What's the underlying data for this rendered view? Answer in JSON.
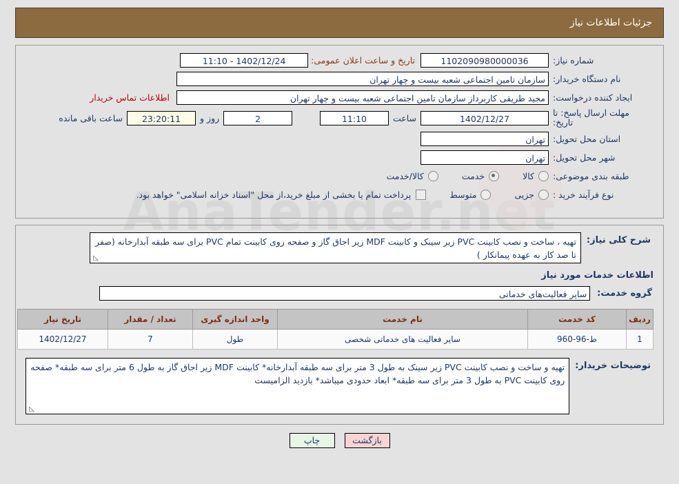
{
  "header": {
    "title": "جزئیات اطلاعات نیاز"
  },
  "colors": {
    "header_bar": "#8b6b3f",
    "page_background": "#e3e3e3",
    "label_text": "#1f3864",
    "link_red": "#c00000",
    "announce_label": "#8a3a10",
    "table_header_bg": "#c4c4c4",
    "table_header_text": "#7b2d13",
    "countdown_bg": "#fdfce4",
    "print_button_bg": "#e7f6e7",
    "back_button_bg": "#fbd3d3"
  },
  "watermark": {
    "text": "AnaTender.net"
  },
  "info": {
    "need_number_label": "شماره نیاز:",
    "need_number_value": "1102090980000036",
    "announce_label": "تاریخ و ساعت اعلان عمومی:",
    "announce_value": "1402/12/24 - 11:10",
    "buyer_org_label": "نام دستگاه خریدار:",
    "buyer_org_value": "سازمان تامین اجتماعی شعبه بیست و چهار تهران",
    "creator_label": "ایجاد کننده درخواست:",
    "creator_value": "مجید طریقی کاربرداز سازمان تامین اجتماعی شعبه بیست و چهار تهران",
    "contact_link": "اطلاعات تماس خریدار",
    "deadline_label_line1": "مهلت ارسال پاسخ: تا",
    "deadline_label_line2": "تاریخ:",
    "deadline_date": "1402/12/27",
    "hour_label": "ساعت",
    "deadline_time": "11:10",
    "days_value": "2",
    "days_label": "روز و",
    "countdown_value": "23:20:11",
    "remaining_label": "ساعت باقی مانده",
    "province_label": "استان محل تحویل:",
    "province_value": "تهران",
    "city_label": "شهر محل تحویل:",
    "city_value": "تهران",
    "category_label": "طبقه بندی موضوعی:",
    "category_options": [
      {
        "label": "کالا",
        "selected": false
      },
      {
        "label": "خدمت",
        "selected": true
      },
      {
        "label": "کالا/خدمت",
        "selected": false
      }
    ],
    "process_label": "نوع فرآیند خرید :",
    "process_options": [
      {
        "label": "جزیی",
        "selected": false
      },
      {
        "label": "متوسط",
        "selected": false
      }
    ],
    "treasury_checkbox_checked": false,
    "treasury_note": "پرداخت تمام یا بخشی از مبلغ خرید،از محل \"اسناد خزانه اسلامی\" خواهد بود."
  },
  "description": {
    "need_summary_label": "شرح کلی نیاز:",
    "need_summary_value": "تهیه ، ساخت و نصب کابینت PVC زیر سینک و کابینت MDF زیر اجاق گاز و صفحه روی کابینت تمام PVC  برای سه طبقه آبدارخانه (صفر تا صد کار به عهده پیمانکار )",
    "services_heading": "اطلاعات خدمات مورد نیاز",
    "service_group_label": "گروه خدمت:",
    "service_group_value": "سایر فعالیت‌های خدماتی",
    "buyer_notes_label": "توضیحات خریدار:",
    "buyer_notes_value": "تهیه و ساخت و نصب کابینت PVC زیر سینک به طول 3 متر برای سه طبقه آبدارخانه* کابینت MDF زیر اجاق گاز به طول 6 متر برای سه طبقه* صفحه روی کابینت PVC به طول 3 متر برای سه طبقه* ابعاد حدودی میباشد* بازدید الزامیست",
    "resize_grip": "◺"
  },
  "table": {
    "columns": [
      "ردیف",
      "کد خدمت",
      "نام خدمت",
      "واحد اندازه گیری",
      "تعداد / مقدار",
      "تاریخ نیاز"
    ],
    "rows": [
      {
        "idx": "1",
        "code": "ط-96-960",
        "name": "سایر فعالیت های خدماتی شخصی",
        "unit": "طول",
        "qty": "7",
        "date": "1402/12/27"
      }
    ]
  },
  "footer": {
    "print_label": "چاپ",
    "back_label": "بازگشت"
  }
}
